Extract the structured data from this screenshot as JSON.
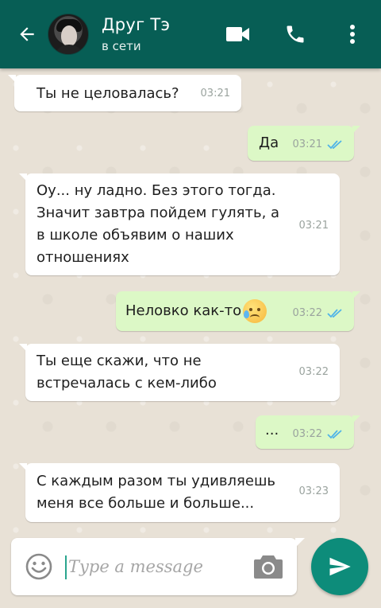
{
  "header": {
    "contact_name": "Друг Тэ",
    "status": "в сети",
    "icons": {
      "back": "arrow-back-icon",
      "video": "video-camera-icon",
      "call": "phone-icon",
      "menu": "more-vert-icon"
    }
  },
  "messages": [
    {
      "direction": "in",
      "text": "Ты не целовалась?",
      "time": "03:21"
    },
    {
      "direction": "out",
      "text": "Да",
      "time": "03:21",
      "status": "read"
    },
    {
      "direction": "in",
      "lines": [
        "Оу... ну ладно.  Без этого тогда.",
        "Значит завтра пойдем гулять, а",
        "в школе объявим о наших",
        "отношениях"
      ],
      "time": "03:21"
    },
    {
      "direction": "out",
      "text": "Неловко как-то",
      "emoji": "sad-sweat-face",
      "time": "03:22",
      "status": "read"
    },
    {
      "direction": "in",
      "lines": [
        "Ты еще скажи, что не",
        "встречалась с кем-либо"
      ],
      "time": "03:22"
    },
    {
      "direction": "out",
      "text": "...",
      "time": "03:22",
      "status": "read"
    },
    {
      "direction": "in",
      "lines": [
        "С каждым разом ты удивляешь",
        "меня все больше и больше..."
      ],
      "time": "03:23"
    }
  ],
  "composer": {
    "placeholder": "Type a message",
    "icons": {
      "emoji": "smiley-icon",
      "camera": "camera-icon",
      "send": "send-icon"
    }
  },
  "colors": {
    "header": "#075e55",
    "outgoing_bubble": "#dcf8c6",
    "incoming_bubble": "#ffffff",
    "read_tick": "#4fb3e8",
    "send_button": "#0d8c7a"
  }
}
